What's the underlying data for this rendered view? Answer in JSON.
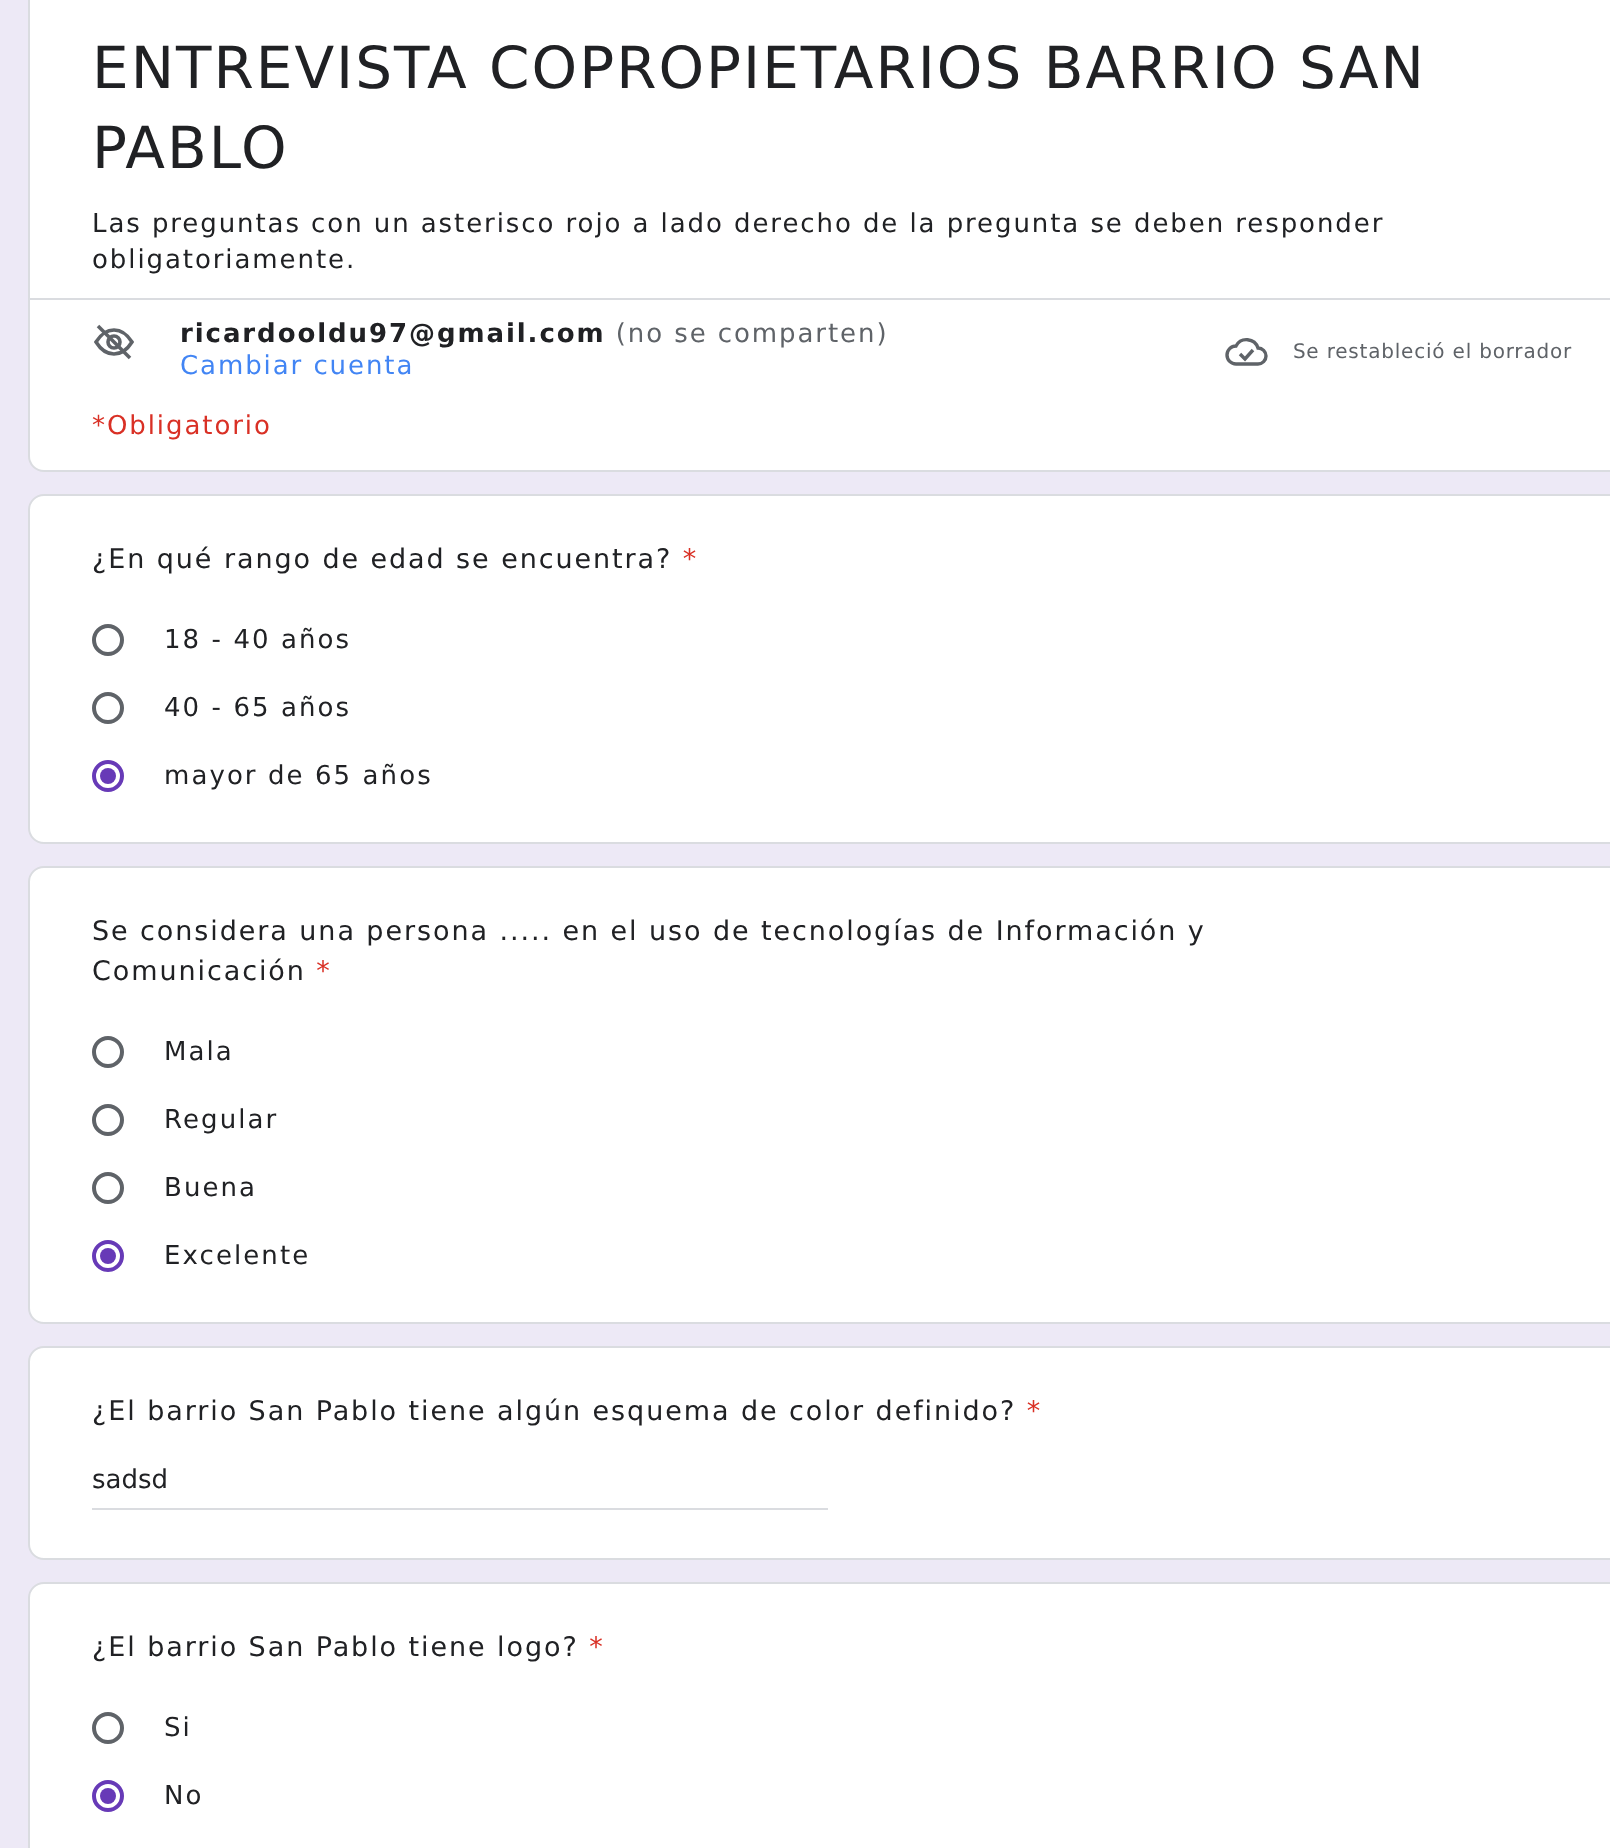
{
  "header": {
    "title": "ENTREVISTA COPROPIETARIOS BARRIO SAN PABLO",
    "description": "Las preguntas con un asterisco rojo a lado derecho de la pregunta se deben responder obligatoriamente.",
    "email": "ricardooldu97@gmail.com",
    "email_note": "(no se comparten)",
    "switch_account": "Cambiar cuenta",
    "draft_status": "Se restableció el borrador",
    "required_note": "*Obligatorio"
  },
  "questions": [
    {
      "kind": "radio",
      "text": "¿En qué rango de edad se encuentra?",
      "required_mark": "*",
      "options": [
        {
          "label": "18 - 40 años",
          "selected": false
        },
        {
          "label": "40 - 65 años",
          "selected": false
        },
        {
          "label": "mayor de 65 años",
          "selected": true
        }
      ]
    },
    {
      "kind": "radio",
      "text": "Se considera una persona ..... en el uso de tecnologías de Información y Comunicación",
      "required_mark": "*",
      "options": [
        {
          "label": "Mala",
          "selected": false
        },
        {
          "label": "Regular",
          "selected": false
        },
        {
          "label": "Buena",
          "selected": false
        },
        {
          "label": "Excelente",
          "selected": true
        }
      ]
    },
    {
      "kind": "text",
      "text": "¿El barrio San Pablo tiene algún esquema de color definido?",
      "required_mark": "*",
      "value": "sadsd"
    },
    {
      "kind": "radio",
      "text": "¿El barrio San Pablo tiene logo?",
      "required_mark": "*",
      "options": [
        {
          "label": "Si",
          "selected": false
        },
        {
          "label": "No",
          "selected": true
        }
      ]
    }
  ]
}
